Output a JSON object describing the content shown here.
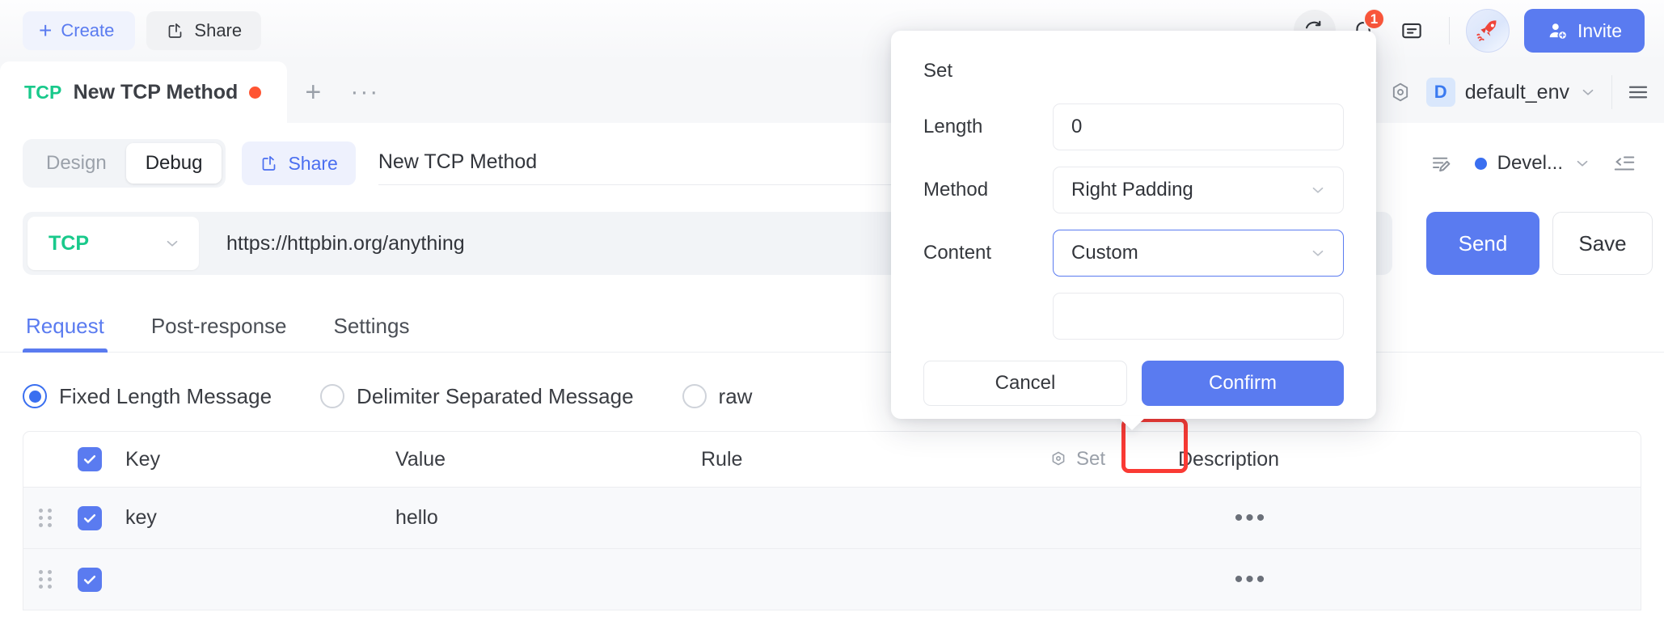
{
  "topbar": {
    "create_label": "Create",
    "share_label": "Share",
    "notification_count": "1",
    "invite_label": "Invite",
    "icons": [
      "sync-icon",
      "bell-icon",
      "panel-icon",
      "rocket-icon",
      "invite-person-icon"
    ]
  },
  "tabstrip": {
    "tab": {
      "protocol": "TCP",
      "title": "New TCP Method",
      "unsaved": true
    },
    "add_tab_label": "+",
    "more_tabs_label": "···",
    "env": {
      "badge": "D",
      "name": "default_env"
    }
  },
  "subbar": {
    "segments": [
      {
        "label": "Design",
        "active": false
      },
      {
        "label": "Debug",
        "active": true
      }
    ],
    "share_label": "Share",
    "name_value": "New TCP Method",
    "status_label": "Devel..."
  },
  "urlbar": {
    "protocol": "TCP",
    "url": "https://httpbin.org/anything",
    "send_label": "Send",
    "save_label": "Save"
  },
  "inner_tabs": [
    {
      "label": "Request",
      "active": true
    },
    {
      "label": "Post-response",
      "active": false
    },
    {
      "label": "Settings",
      "active": false
    }
  ],
  "message_mode": [
    {
      "label": "Fixed Length Message",
      "checked": true
    },
    {
      "label": "Delimiter Separated Message",
      "checked": false
    },
    {
      "label": "raw",
      "checked": false
    }
  ],
  "table": {
    "headers": {
      "key": "Key",
      "value": "Value",
      "rule": "Rule",
      "set": "Set",
      "description": "Description"
    },
    "rows": [
      {
        "key": "key",
        "value": "hello",
        "rule": "",
        "description": "",
        "checked": true,
        "more": "•••"
      },
      {
        "key": "",
        "value": "",
        "rule": "",
        "description": "",
        "checked": true,
        "more": "•••"
      }
    ]
  },
  "popup": {
    "title": "Set",
    "fields": [
      {
        "label": "Length",
        "value": "0",
        "type": "input"
      },
      {
        "label": "Method",
        "value": "Right Padding",
        "type": "select"
      },
      {
        "label": "Content",
        "value": "Custom",
        "type": "select",
        "focused": true
      },
      {
        "label": "",
        "value": "",
        "type": "input"
      }
    ],
    "cancel_label": "Cancel",
    "confirm_label": "Confirm"
  },
  "colors": {
    "accent": "#5a7bf0",
    "protocol_green": "#19c98b",
    "unsaved_dot": "#ff5533",
    "badge_red": "#f9563b",
    "highlight_red": "#fa3a34"
  }
}
